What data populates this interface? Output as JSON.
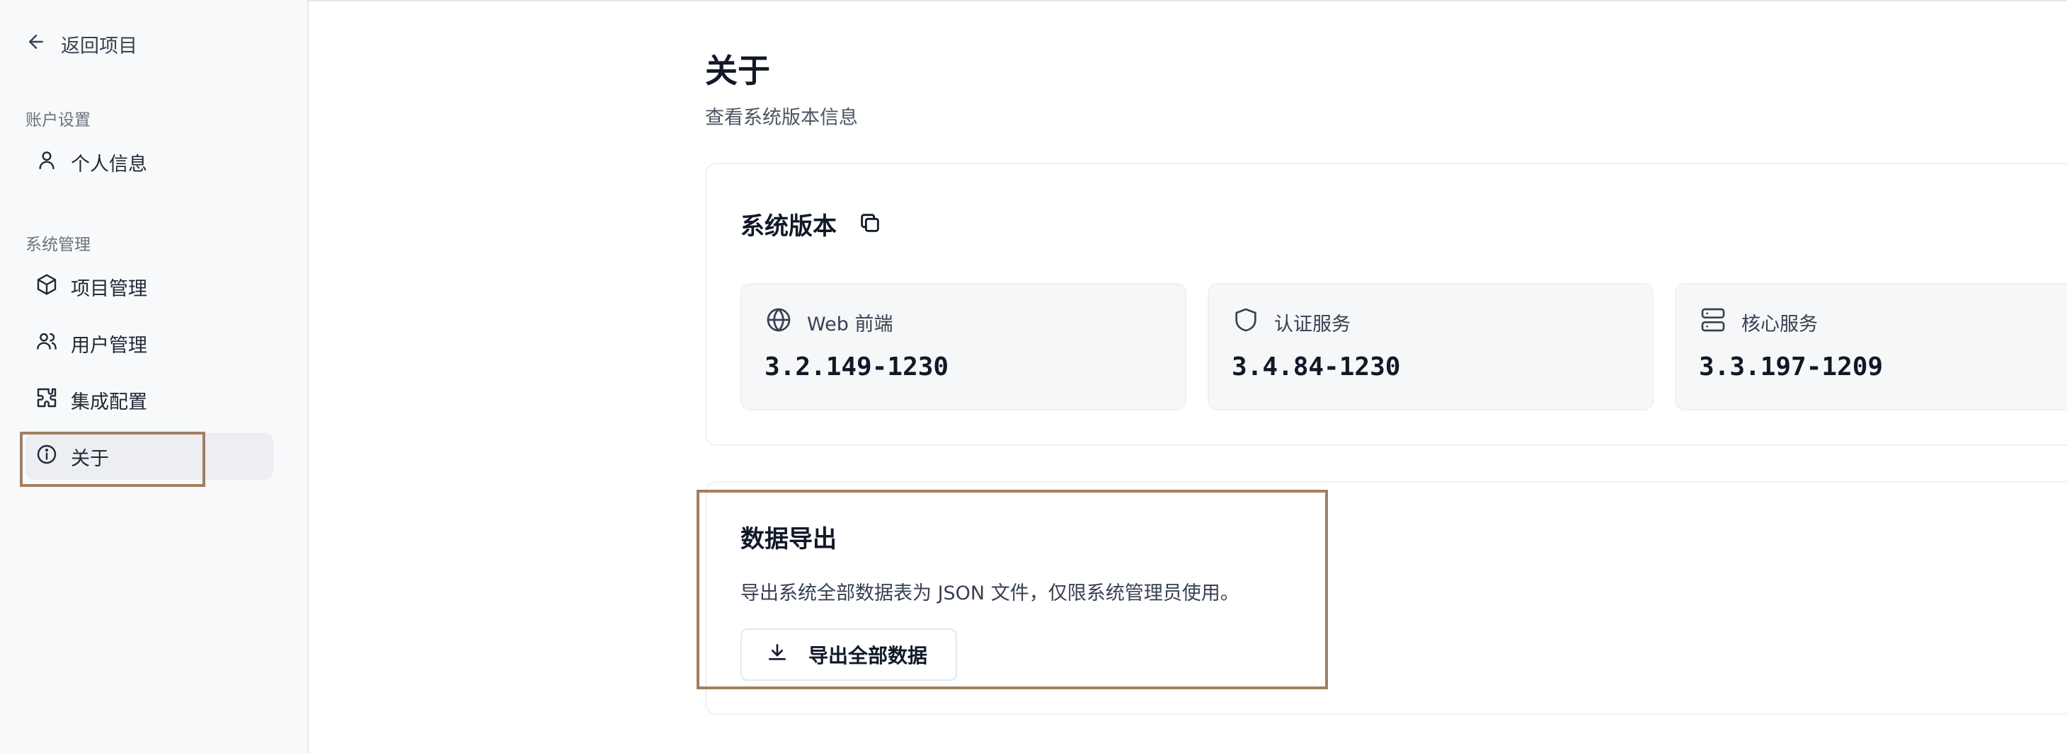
{
  "sidebar": {
    "back_label": "返回项目",
    "sections": [
      {
        "title": "账户设置"
      },
      {
        "title": "系统管理"
      }
    ],
    "items": [
      {
        "label": "个人信息",
        "icon": "user-icon"
      },
      {
        "label": "项目管理",
        "icon": "package-icon"
      },
      {
        "label": "用户管理",
        "icon": "users-icon"
      },
      {
        "label": "集成配置",
        "icon": "puzzle-icon"
      },
      {
        "label": "关于",
        "icon": "info-icon",
        "active": true
      }
    ]
  },
  "page": {
    "title": "关于",
    "subtitle": "查看系统版本信息"
  },
  "version_card": {
    "title": "系统版本",
    "copy_icon": "copy-icon",
    "tiles": [
      {
        "label": "Web 前端",
        "icon": "globe-icon",
        "version": "3.2.149-1230"
      },
      {
        "label": "认证服务",
        "icon": "shield-icon",
        "version": "3.4.84-1230"
      },
      {
        "label": "核心服务",
        "icon": "server-icon",
        "version": "3.3.197-1209"
      }
    ]
  },
  "export_card": {
    "title": "数据导出",
    "description": "导出系统全部数据表为 JSON 文件，仅限系统管理员使用。",
    "button_label": "导出全部数据",
    "button_icon": "download-icon"
  },
  "colors": {
    "highlight": "#a17f63",
    "sidebar_bg": "#f8f9fa",
    "tile_bg": "#f6f7f9"
  }
}
